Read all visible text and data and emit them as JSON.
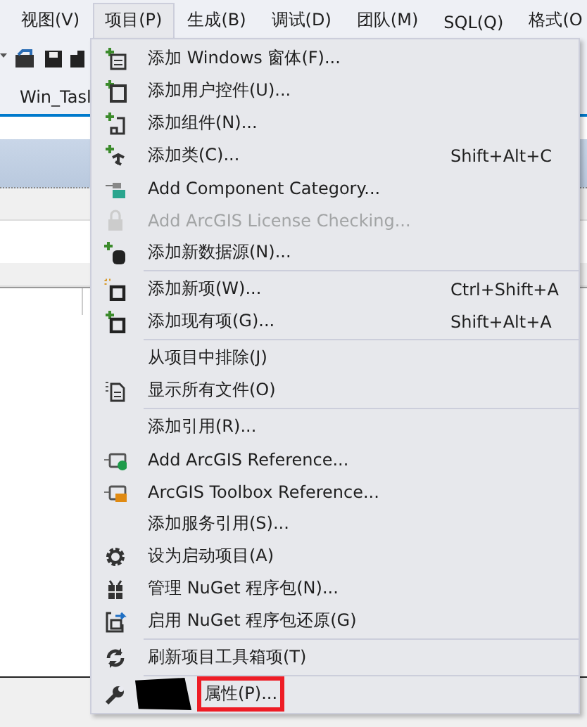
{
  "menu_bar": [
    {
      "label": "视图(V)",
      "selected": false
    },
    {
      "label": "项目(P)",
      "selected": true
    },
    {
      "label": "生成(B)",
      "selected": false
    },
    {
      "label": "调试(D)",
      "selected": false
    },
    {
      "label": "团队(M)",
      "selected": false
    },
    {
      "label": "SQL(Q)",
      "selected": false
    },
    {
      "label": "格式(O",
      "selected": false
    }
  ],
  "document_tab": {
    "label": "Win_Tasl"
  },
  "menu": [
    {
      "kind": "item",
      "label": "添加 Windows 窗体(F)...",
      "disabled": false,
      "highlighted": false,
      "redacted": false
    },
    {
      "kind": "item",
      "label": "添加用户控件(U)...",
      "disabled": false,
      "highlighted": false,
      "redacted": false
    },
    {
      "kind": "item",
      "label": "添加组件(N)...",
      "disabled": false,
      "highlighted": false,
      "redacted": false
    },
    {
      "kind": "item",
      "label": "添加类(C)...",
      "shortcut": "Shift+Alt+C",
      "disabled": false,
      "highlighted": false,
      "redacted": false
    },
    {
      "kind": "item",
      "label": "Add Component Category...",
      "disabled": false,
      "highlighted": false,
      "redacted": false
    },
    {
      "kind": "item",
      "label": "Add ArcGIS License Checking...",
      "disabled": true,
      "highlighted": false,
      "redacted": false
    },
    {
      "kind": "item",
      "label": "添加新数据源(N)...",
      "disabled": false,
      "highlighted": false,
      "redacted": false
    },
    {
      "kind": "separator"
    },
    {
      "kind": "item",
      "label": "添加新项(W)...",
      "shortcut": "Ctrl+Shift+A",
      "disabled": false,
      "highlighted": false,
      "redacted": false
    },
    {
      "kind": "item",
      "label": "添加现有项(G)...",
      "shortcut": "Shift+Alt+A",
      "disabled": false,
      "highlighted": false,
      "redacted": false
    },
    {
      "kind": "separator"
    },
    {
      "kind": "item",
      "label": "从项目中排除(J)",
      "disabled": false,
      "highlighted": false,
      "redacted": false
    },
    {
      "kind": "item",
      "label": "显示所有文件(O)",
      "disabled": false,
      "highlighted": false,
      "redacted": false
    },
    {
      "kind": "separator"
    },
    {
      "kind": "item",
      "label": "添加引用(R)...",
      "disabled": false,
      "highlighted": false,
      "redacted": false
    },
    {
      "kind": "item",
      "label": "Add ArcGIS Reference...",
      "disabled": false,
      "highlighted": false,
      "redacted": false
    },
    {
      "kind": "item",
      "label": "ArcGIS Toolbox Reference...",
      "disabled": false,
      "highlighted": false,
      "redacted": false
    },
    {
      "kind": "item",
      "label": "添加服务引用(S)...",
      "disabled": false,
      "highlighted": false,
      "redacted": false
    },
    {
      "kind": "item",
      "label": "设为启动项目(A)",
      "disabled": false,
      "highlighted": false,
      "redacted": false
    },
    {
      "kind": "item",
      "label": "管理 NuGet 程序包(N)...",
      "disabled": false,
      "highlighted": false,
      "redacted": false
    },
    {
      "kind": "item",
      "label": "启用 NuGet 程序包还原(G)",
      "disabled": false,
      "highlighted": false,
      "redacted": false
    },
    {
      "kind": "separator"
    },
    {
      "kind": "item",
      "label": "刷新项目工具箱项(T)",
      "disabled": false,
      "highlighted": false,
      "redacted": false
    },
    {
      "kind": "separator"
    },
    {
      "kind": "item",
      "label": "属性(P)...",
      "disabled": false,
      "highlighted": true,
      "redacted": true
    }
  ]
}
